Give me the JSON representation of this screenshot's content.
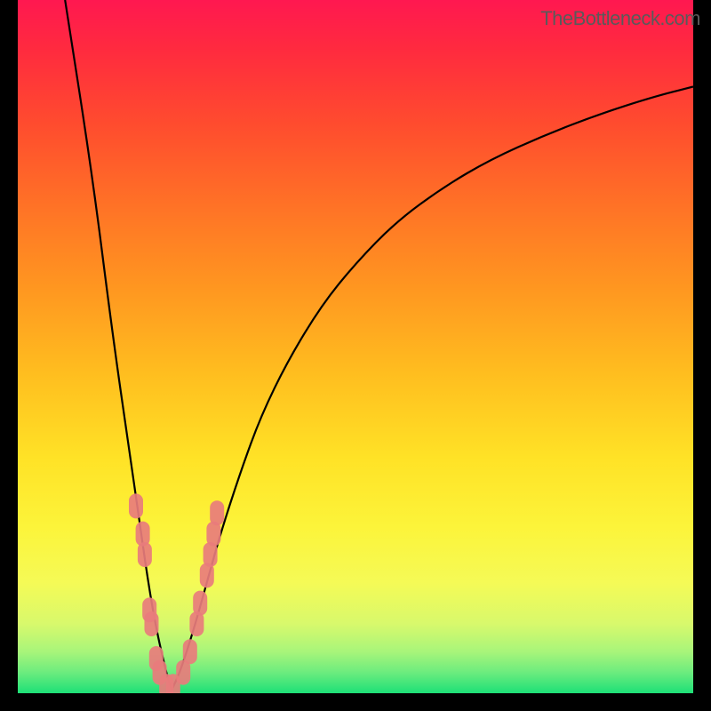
{
  "watermark": "TheBottleneck.com",
  "chart_data": {
    "type": "line",
    "title": "",
    "xlabel": "",
    "ylabel": "",
    "xlim": [
      0,
      100
    ],
    "ylim": [
      0,
      100
    ],
    "description": "Bottleneck curve showing optimal match point at minimum. Left branch steep descent, right branch logarithmic-like ascent. Background gradient red (high bottleneck) through orange/yellow to green (optimal). Pink/salmon dots clustered near minimum indicate sample data points.",
    "curve_left": {
      "x": [
        7,
        11,
        14,
        16.5,
        18,
        19,
        20,
        20.8,
        21.5,
        22,
        22.4,
        22.8
      ],
      "y": [
        100,
        75,
        52,
        35,
        25,
        18,
        12,
        8,
        5,
        3,
        1.5,
        0.5
      ]
    },
    "curve_right": {
      "x": [
        22.8,
        24,
        26,
        28,
        30,
        33,
        36,
        40,
        45,
        50,
        56,
        63,
        70,
        78,
        86,
        94,
        100
      ],
      "y": [
        0.5,
        3,
        9,
        16,
        23,
        32,
        40,
        48,
        56,
        62,
        68,
        73,
        77,
        80.5,
        83.5,
        86,
        87.5
      ]
    },
    "minimum_x": 22.8,
    "data_points": [
      {
        "x": 17.5,
        "y": 27
      },
      {
        "x": 18.5,
        "y": 23
      },
      {
        "x": 18.8,
        "y": 20
      },
      {
        "x": 19.5,
        "y": 12
      },
      {
        "x": 19.8,
        "y": 10
      },
      {
        "x": 20.5,
        "y": 5
      },
      {
        "x": 21,
        "y": 3
      },
      {
        "x": 22,
        "y": 1
      },
      {
        "x": 23,
        "y": 1
      },
      {
        "x": 24.5,
        "y": 3
      },
      {
        "x": 25.5,
        "y": 6
      },
      {
        "x": 26.5,
        "y": 10
      },
      {
        "x": 27,
        "y": 13
      },
      {
        "x": 28,
        "y": 17
      },
      {
        "x": 28.5,
        "y": 20
      },
      {
        "x": 29,
        "y": 23
      },
      {
        "x": 29.5,
        "y": 26
      }
    ],
    "gradient_stops": [
      {
        "offset": 0,
        "color": "#ff1850"
      },
      {
        "offset": 0.07,
        "color": "#ff2a3f"
      },
      {
        "offset": 0.18,
        "color": "#ff4c2e"
      },
      {
        "offset": 0.3,
        "color": "#ff7326"
      },
      {
        "offset": 0.42,
        "color": "#ff9820"
      },
      {
        "offset": 0.54,
        "color": "#ffbe1f"
      },
      {
        "offset": 0.66,
        "color": "#ffe226"
      },
      {
        "offset": 0.76,
        "color": "#fcf43a"
      },
      {
        "offset": 0.84,
        "color": "#f5fa56"
      },
      {
        "offset": 0.9,
        "color": "#d8f96c"
      },
      {
        "offset": 0.94,
        "color": "#a8f57a"
      },
      {
        "offset": 0.97,
        "color": "#6cec7e"
      },
      {
        "offset": 1.0,
        "color": "#1de077"
      }
    ],
    "point_color": "#e87c7c"
  }
}
